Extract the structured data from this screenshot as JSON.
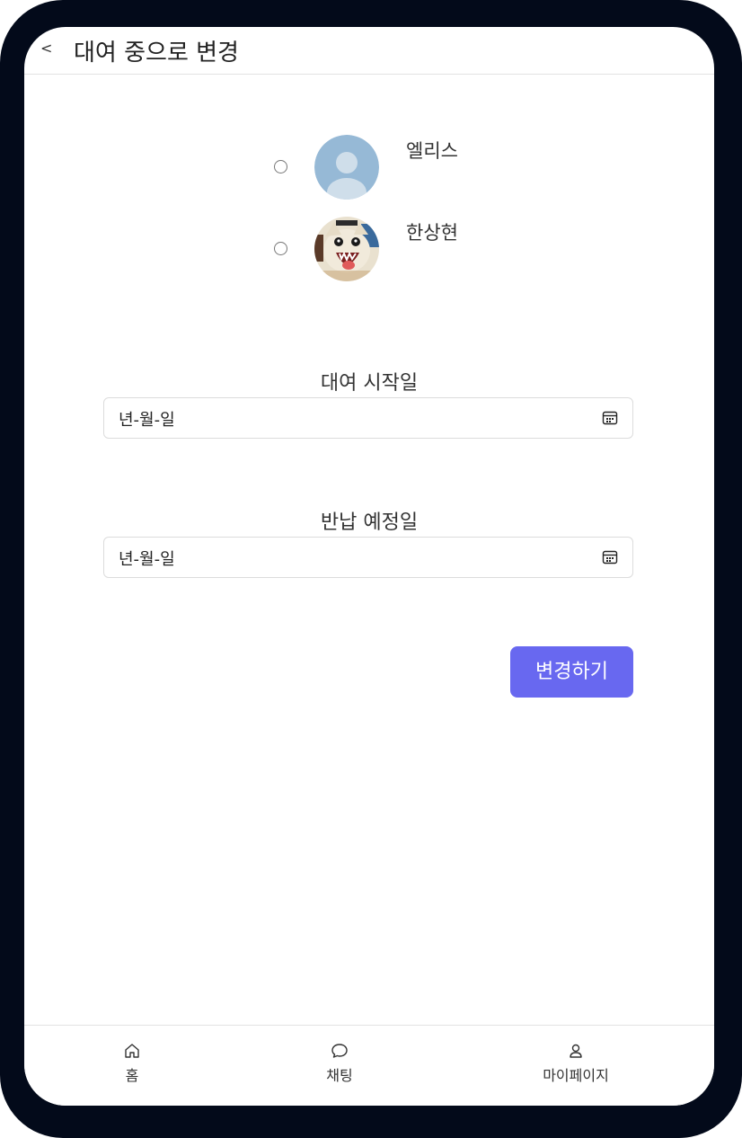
{
  "header": {
    "back_label": "<",
    "title": "대여 중으로 변경"
  },
  "users": [
    {
      "name": "엘리스",
      "avatar": "default-avatar"
    },
    {
      "name": "한상현",
      "avatar": "profile-photo"
    }
  ],
  "form": {
    "start": {
      "label": "대여 시작일",
      "placeholder": "년-월-일"
    },
    "end": {
      "label": "반납 예정일",
      "placeholder": "년-월-일"
    },
    "submit_label": "변경하기"
  },
  "nav": {
    "items": [
      {
        "label": "홈",
        "icon": "home-icon"
      },
      {
        "label": "채팅",
        "icon": "chat-icon"
      },
      {
        "label": "마이페이지",
        "icon": "user-icon"
      }
    ]
  },
  "colors": {
    "frame": "#030a1a",
    "accent": "#6868f0"
  }
}
